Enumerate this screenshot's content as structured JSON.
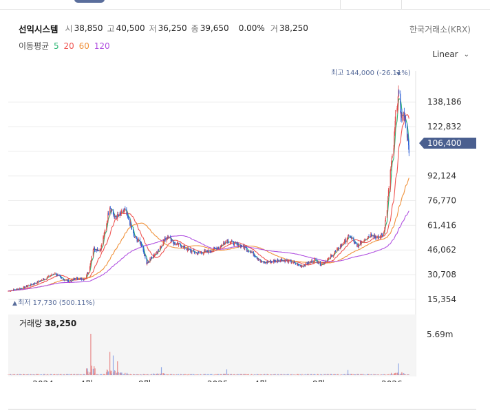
{
  "stock": {
    "name": "선익시스템",
    "open_label": "시",
    "open": "38,850",
    "high_label": "고",
    "high": "40,500",
    "low_label": "저",
    "low": "36,250",
    "close_label": "종",
    "close": "39,650",
    "change": "0.00%",
    "volume_label": "거",
    "volume": "38,250"
  },
  "exchange": "한국거래소(KRX)",
  "scale": {
    "selected": "Linear"
  },
  "ma_legend": {
    "title": "이동평균",
    "items": [
      {
        "label": "5",
        "color": "#2bb673"
      },
      {
        "label": "20",
        "color": "#ef5350"
      },
      {
        "label": "60",
        "color": "#f0913a"
      },
      {
        "label": "120",
        "color": "#b04fe0"
      }
    ]
  },
  "volume_panel": {
    "label": "거래량",
    "value": "38,250",
    "axis_max_label": "5.69m"
  },
  "annotations": {
    "high": "최고 144,000 (-26.11%)",
    "low": "최저 17,730 (500.11%)",
    "last_price": "106,400"
  },
  "chart_data": {
    "type": "candlestick",
    "y_axis": {
      "scale": "linear",
      "ticks": [
        138186,
        122832,
        107478,
        92124,
        76770,
        61416,
        46062,
        30708,
        15354
      ],
      "tick_labels": [
        "138,186",
        "122,832",
        "",
        "92,124",
        "76,770",
        "61,416",
        "46,062",
        "30,708",
        "15,354"
      ],
      "range": [
        11000,
        149000
      ]
    },
    "x_axis": {
      "ticks": [
        "2024",
        "4월",
        "8월",
        "2025",
        "4월",
        "8월",
        "2026"
      ],
      "tick_dates": [
        "2024-01-01",
        "2024-04-01",
        "2024-08-01",
        "2025-01-01",
        "2025-04-01",
        "2025-08-01",
        "2026-01-01"
      ],
      "range": [
        "2023-10-20",
        "2026-02-20"
      ]
    },
    "price_path": [
      [
        "2023-10-20",
        20500
      ],
      [
        "2023-11-20",
        22500
      ],
      [
        "2023-12-20",
        26000
      ],
      [
        "2024-01-10",
        29000
      ],
      [
        "2024-01-25",
        31500
      ],
      [
        "2024-02-10",
        28000
      ],
      [
        "2024-02-25",
        26500
      ],
      [
        "2024-03-10",
        28500
      ],
      [
        "2024-03-25",
        27500
      ],
      [
        "2024-04-05",
        32000
      ],
      [
        "2024-04-15",
        47000
      ],
      [
        "2024-04-30",
        46000
      ],
      [
        "2024-05-10",
        58000
      ],
      [
        "2024-05-20",
        74000
      ],
      [
        "2024-05-30",
        66000
      ],
      [
        "2024-06-10",
        68000
      ],
      [
        "2024-06-20",
        71000
      ],
      [
        "2024-07-01",
        63000
      ],
      [
        "2024-07-10",
        54000
      ],
      [
        "2024-07-25",
        50000
      ],
      [
        "2024-08-05",
        38000
      ],
      [
        "2024-08-15",
        41000
      ],
      [
        "2024-08-30",
        46000
      ],
      [
        "2024-09-10",
        52000
      ],
      [
        "2024-09-20",
        55000
      ],
      [
        "2024-10-01",
        50000
      ],
      [
        "2024-10-15",
        49000
      ],
      [
        "2024-11-01",
        46000
      ],
      [
        "2024-11-20",
        44000
      ],
      [
        "2024-12-10",
        45000
      ],
      [
        "2025-01-05",
        48000
      ],
      [
        "2025-01-20",
        52000
      ],
      [
        "2025-02-05",
        50000
      ],
      [
        "2025-02-25",
        48000
      ],
      [
        "2025-03-15",
        44000
      ],
      [
        "2025-04-05",
        38000
      ],
      [
        "2025-04-25",
        39000
      ],
      [
        "2025-05-15",
        40000
      ],
      [
        "2025-06-05",
        38500
      ],
      [
        "2025-06-25",
        36000
      ],
      [
        "2025-07-10",
        38000
      ],
      [
        "2025-07-25",
        40000
      ],
      [
        "2025-08-05",
        37000
      ],
      [
        "2025-08-20",
        40000
      ],
      [
        "2025-09-05",
        45000
      ],
      [
        "2025-09-20",
        50000
      ],
      [
        "2025-10-05",
        55000
      ],
      [
        "2025-10-20",
        48000
      ],
      [
        "2025-11-05",
        53000
      ],
      [
        "2025-11-20",
        56000
      ],
      [
        "2025-12-05",
        53000
      ],
      [
        "2025-12-15",
        57000
      ],
      [
        "2025-12-22",
        72000
      ],
      [
        "2025-12-29",
        95000
      ],
      [
        "2026-01-05",
        110000
      ],
      [
        "2026-01-10",
        135000
      ],
      [
        "2026-01-15",
        142000
      ],
      [
        "2026-01-22",
        128000
      ],
      [
        "2026-01-28",
        130000
      ],
      [
        "2026-02-03",
        116000
      ],
      [
        "2026-02-06",
        106400
      ]
    ],
    "moving_averages": [
      {
        "name": "5",
        "color": "#2bb673"
      },
      {
        "name": "20",
        "color": "#ef5350"
      },
      {
        "name": "60",
        "color": "#f0913a"
      },
      {
        "name": "120",
        "color": "#b04fe0"
      }
    ],
    "high_point": {
      "date": "2026-01-15",
      "value": 144000
    },
    "low_point": {
      "date": "2023-10-25",
      "value": 17730
    },
    "last_price": 106400,
    "volume_series": [
      {
        "date": "2024-04-10",
        "volume": 5690000
      },
      {
        "date": "2024-05-20",
        "volume": 3200000
      },
      {
        "date": "2024-05-27",
        "volume": 2700000
      },
      {
        "date": "2024-06-05",
        "volume": 1900000
      },
      {
        "date": "2024-06-15",
        "volume": 1300000
      },
      {
        "date": "2024-08-25",
        "volume": 900000
      },
      {
        "date": "2024-09-05",
        "volume": 1100000
      },
      {
        "date": "2025-01-20",
        "volume": 800000
      },
      {
        "date": "2025-10-01",
        "volume": 700000
      },
      {
        "date": "2026-01-10",
        "volume": 1400000
      },
      {
        "date": "2026-01-15",
        "volume": 1600000
      }
    ],
    "volume_axis_max": 5690000
  }
}
